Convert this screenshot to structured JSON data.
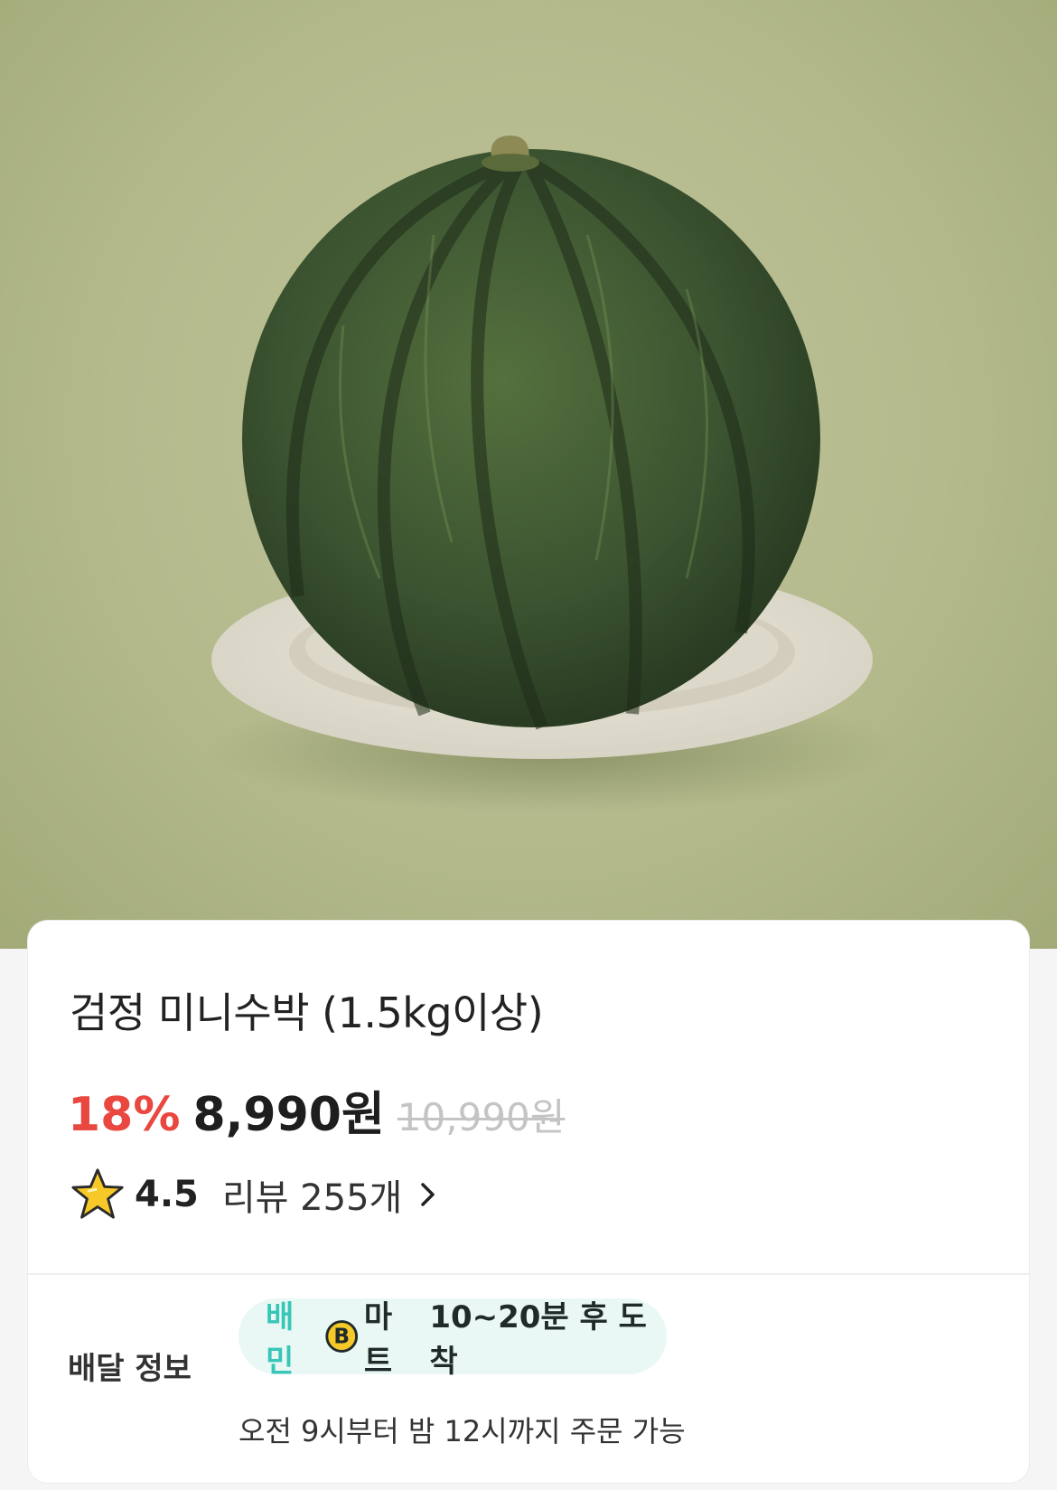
{
  "product": {
    "image_alt": "black mini watermelon on a plate",
    "title": "검정 미니수박 (1.5kg이상)",
    "discount": "18%",
    "price": "8,990원",
    "original_price": "10,990원"
  },
  "rating": {
    "score": "4.5",
    "reviews": "리뷰 255개",
    "icon": "star-icon"
  },
  "delivery": {
    "label": "배달 정보",
    "brand_prefix": "배민",
    "brand_suffix": "마트",
    "eta": "10~20분 후 도착",
    "hours": "오전 9시부터 밤 12시까지 주문 가능"
  },
  "colors": {
    "discount": "#e9473f",
    "brand_accent": "#37c6b7",
    "pill_bg": "#e9f8f5"
  }
}
